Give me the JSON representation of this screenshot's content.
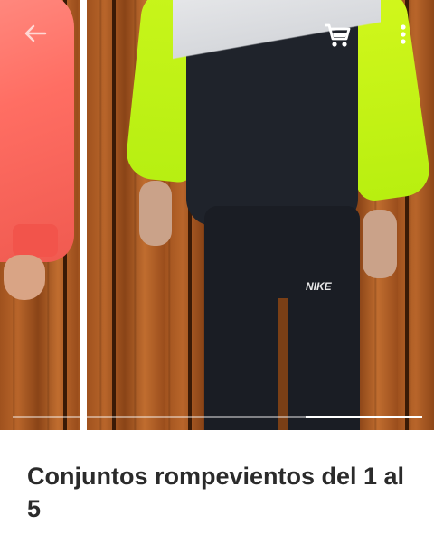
{
  "product": {
    "title": "Conjuntos rompevientos del 1 al 5"
  },
  "gallery": {
    "main_photo_brand_text": "NIKE",
    "active_index": 1,
    "indicator_segments": 3
  },
  "toolbar": {
    "icons": [
      "back-arrow-icon",
      "shopping-cart-icon",
      "more-vert-icon"
    ]
  },
  "colors": {
    "accent_white": "#ffffff",
    "title_text": "#2b2b2b",
    "wood": "#b8652a",
    "jacket_neon": "#c8f51a"
  }
}
